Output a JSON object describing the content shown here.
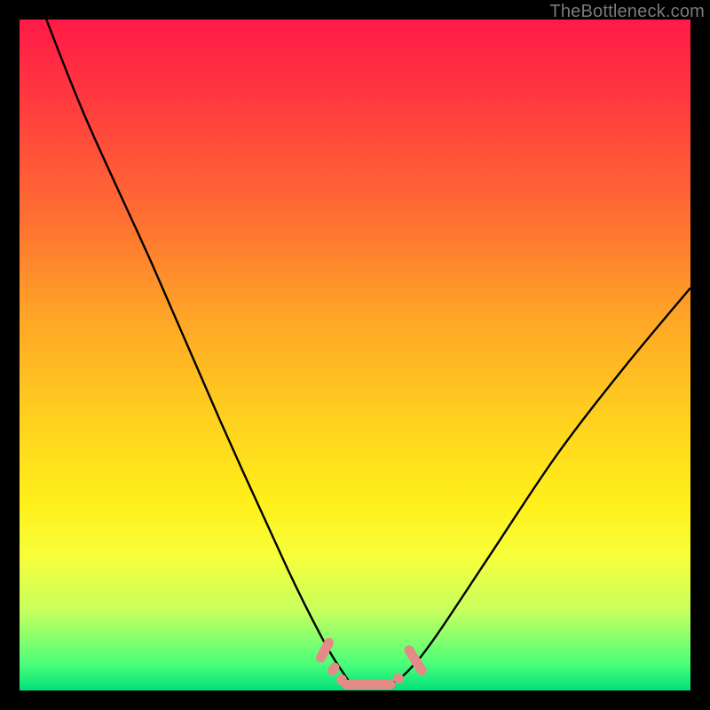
{
  "watermark": "TheBottleneck.com",
  "chart_data": {
    "type": "line",
    "title": "",
    "xlabel": "",
    "ylabel": "",
    "xlim": [
      0,
      100
    ],
    "ylim": [
      0,
      100
    ],
    "grid": false,
    "legend": false,
    "background_gradient": {
      "direction": "vertical",
      "stops": [
        {
          "pos": 0,
          "color": "#ff1a47"
        },
        {
          "pos": 45,
          "color": "#ffa726"
        },
        {
          "pos": 72,
          "color": "#fff01a"
        },
        {
          "pos": 96,
          "color": "#4cff7a"
        },
        {
          "pos": 100,
          "color": "#00e07a"
        }
      ]
    },
    "series": [
      {
        "name": "bottleneck-curve",
        "stroke": "#000000",
        "x": [
          4,
          10,
          20,
          30,
          40,
          45,
          48,
          50,
          55,
          58,
          62,
          70,
          80,
          90,
          100
        ],
        "y": [
          100,
          85,
          63,
          40,
          18,
          8,
          3,
          1,
          1,
          3,
          8,
          20,
          35,
          48,
          60
        ]
      }
    ],
    "annotations": [
      {
        "name": "valley-markers",
        "shape": "rounded-dash",
        "color": "#e58b87",
        "points": [
          {
            "x": 45.5,
            "y": 6.0,
            "len": 4.0,
            "angle": -62
          },
          {
            "x": 46.8,
            "y": 3.2,
            "len": 2.0,
            "angle": -55
          },
          {
            "x": 48.0,
            "y": 1.6,
            "len": 1.6,
            "angle": -35
          },
          {
            "x": 52.0,
            "y": 0.9,
            "len": 8.0,
            "angle": 0
          },
          {
            "x": 56.5,
            "y": 1.8,
            "len": 1.6,
            "angle": 30
          },
          {
            "x": 59.0,
            "y": 4.5,
            "len": 5.0,
            "angle": 58
          }
        ]
      }
    ]
  }
}
